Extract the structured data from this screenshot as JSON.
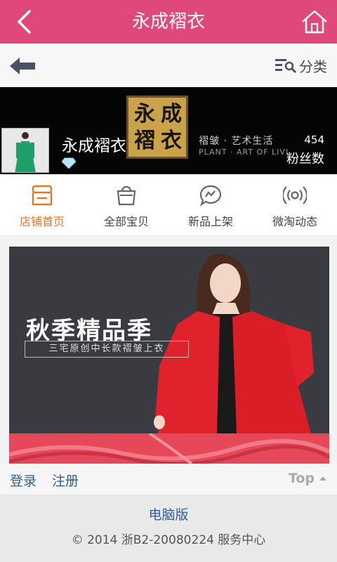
{
  "header": {
    "title": "永成褶衣"
  },
  "subbar": {
    "category_label": "分类"
  },
  "store": {
    "logo_chars": [
      "永",
      "成",
      "褶",
      "衣"
    ],
    "slogan": "褶皱 · 艺术生活",
    "slogan_en": "PLANT · ART OF LIVI",
    "name": "永成褶衣",
    "fans_count": "454",
    "fans_label": "粉丝数"
  },
  "tabs": [
    {
      "label": "店铺首页",
      "icon": "store-icon",
      "active": true
    },
    {
      "label": "全部宝贝",
      "icon": "bag-icon",
      "active": false
    },
    {
      "label": "新品上架",
      "icon": "chat-bubble-icon",
      "active": false
    },
    {
      "label": "微淘动态",
      "icon": "broadcast-icon",
      "active": false
    }
  ],
  "banner": {
    "title": "秋季精品季",
    "subtitle": "三宅原创中长款褶皱上衣"
  },
  "footer": {
    "login": "登录",
    "register": "注册",
    "top": "Top",
    "pc_version": "电脑版",
    "copyright": "© 2014 浙B2-20080224 服务中心"
  },
  "colors": {
    "header": "#e0487a",
    "active_tab": "#e2772a",
    "link": "#2f5c97"
  }
}
